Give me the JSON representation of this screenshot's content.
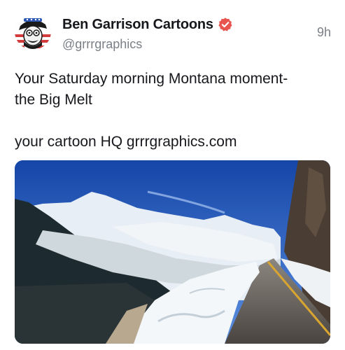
{
  "author": {
    "display_name": "Ben Garrison Cartoons",
    "handle": "@grrrgraphics",
    "avatar_icon": "cartoon-character-avatar",
    "verified_icon": "verified-badge-icon",
    "verified_color": "#e8554e"
  },
  "post": {
    "time": "9h",
    "line1": "Your Saturday morning Montana moment-",
    "line2": "the Big Melt",
    "line3": "your cartoon HQ grrrgraphics.com"
  },
  "media": {
    "type": "photo",
    "description_icon": "mountain-road-snow-photo"
  },
  "colors": {
    "text_primary": "#16181c",
    "text_secondary": "#7a7f86",
    "sky": "#1b4fa8"
  }
}
